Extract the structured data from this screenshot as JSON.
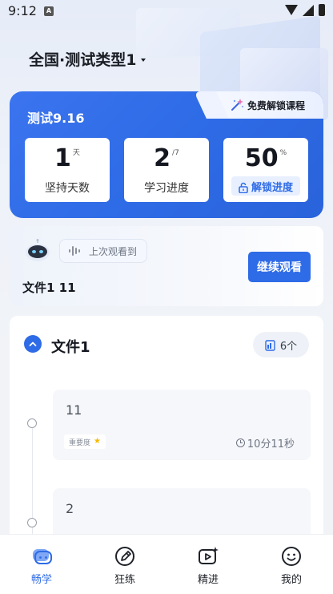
{
  "status_bar": {
    "time": "9:12",
    "notification_badge": "A"
  },
  "header": {
    "title": "全国·测试类型1"
  },
  "progress_card": {
    "title": "测试9.16",
    "unlock_course_label": "免费解锁课程",
    "stats": [
      {
        "value": "1",
        "unit": "天",
        "label": "坚持天数"
      },
      {
        "value": "2",
        "unit": "/7",
        "label": "学习进度"
      },
      {
        "value": "50",
        "unit": "%",
        "label": ""
      }
    ],
    "unlock_progress_label": "解锁进度"
  },
  "continue_watching": {
    "last_watched_label": "上次观看到",
    "file_name": "文件1 11",
    "continue_button": "继续观看"
  },
  "course_section": {
    "title": "文件1",
    "count": "6个",
    "lessons": [
      {
        "name": "11",
        "importance_label": "重要度",
        "duration": "10分11秒"
      },
      {
        "name": "2"
      }
    ]
  },
  "bottom_nav": {
    "items": [
      {
        "label": "畅学",
        "icon": "chat-bubble-icon",
        "active": true
      },
      {
        "label": "狂练",
        "icon": "pen-icon",
        "active": false
      },
      {
        "label": "精进",
        "icon": "video-play-icon",
        "active": false
      },
      {
        "label": "我的",
        "icon": "smile-face-icon",
        "active": false
      }
    ]
  },
  "colors": {
    "accent": "#2e6be6",
    "star": "#f6b800"
  }
}
